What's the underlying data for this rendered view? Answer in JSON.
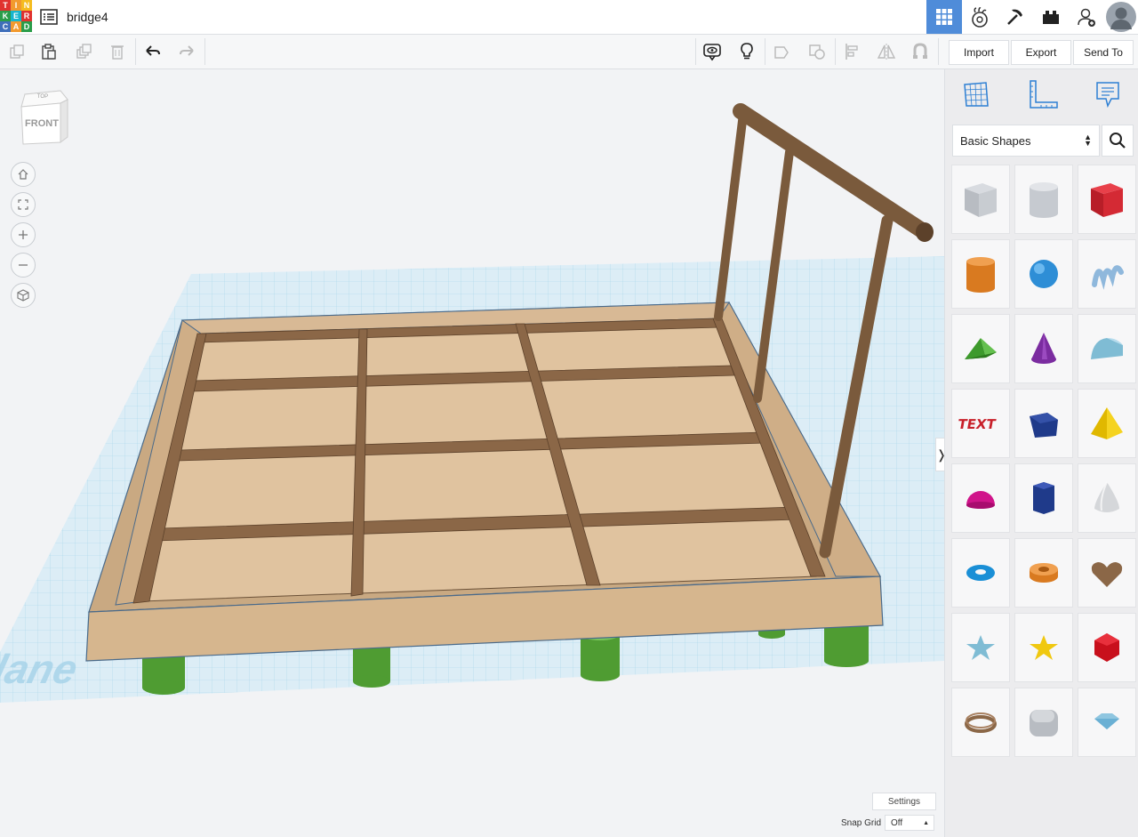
{
  "header": {
    "logo_letters": [
      "T",
      "I",
      "N",
      "K",
      "E",
      "R",
      "C",
      "A",
      "D"
    ],
    "logo_colors": [
      "#e0322f",
      "#f29a2e",
      "#f5bc1f",
      "#2a9d4a",
      "#17b5cf",
      "#e0322f",
      "#3f6fba",
      "#f29a2e",
      "#2a9d4a"
    ],
    "design_title": "bridge4",
    "right_buttons": [
      "grid-view-icon",
      "tinker-icon",
      "minecraft-icon",
      "lego-icon",
      "user-add-icon"
    ]
  },
  "toolbar": {
    "tools": [
      "copy-icon",
      "paste-icon",
      "duplicate-icon",
      "delete-icon",
      "undo-icon",
      "redo-icon",
      "show-all-icon",
      "notes-icon",
      "group-icon",
      "ungroup-icon",
      "align-icon",
      "mirror-icon",
      "cruise-icon"
    ],
    "import_label": "Import",
    "export_label": "Export",
    "send_to_label": "Send To"
  },
  "workplane": {
    "label": "Workplane",
    "viewcube_top": "TOP",
    "viewcube_front": "FRONT",
    "nav_buttons": [
      "home-icon",
      "fit-view-icon",
      "zoom-in-icon",
      "zoom-out-icon",
      "perspective-icon"
    ],
    "settings_label": "Settings",
    "snap_grid_label": "Snap Grid",
    "snap_grid_value": "Off"
  },
  "panel": {
    "tabs": [
      "workplane-icon",
      "ruler-icon",
      "notes-icon"
    ],
    "category": "Basic Shapes",
    "shapes": [
      "box-hole",
      "cylinder-hole",
      "box",
      "cylinder",
      "sphere",
      "scribble",
      "roof",
      "cone",
      "round-roof",
      "text",
      "polygon",
      "pyramid",
      "half-sphere",
      "hexagonal-prism",
      "paraboloid",
      "torus",
      "tube",
      "heart",
      "star",
      "star-yellow",
      "icosahedron",
      "ring",
      "rounded-box",
      "diamond"
    ],
    "text_shape_label": "TEXT"
  },
  "colors": {
    "accent": "#4f8cd9",
    "wood": "#d2b48c",
    "beam": "#8b6747",
    "leg": "#56a83e"
  }
}
